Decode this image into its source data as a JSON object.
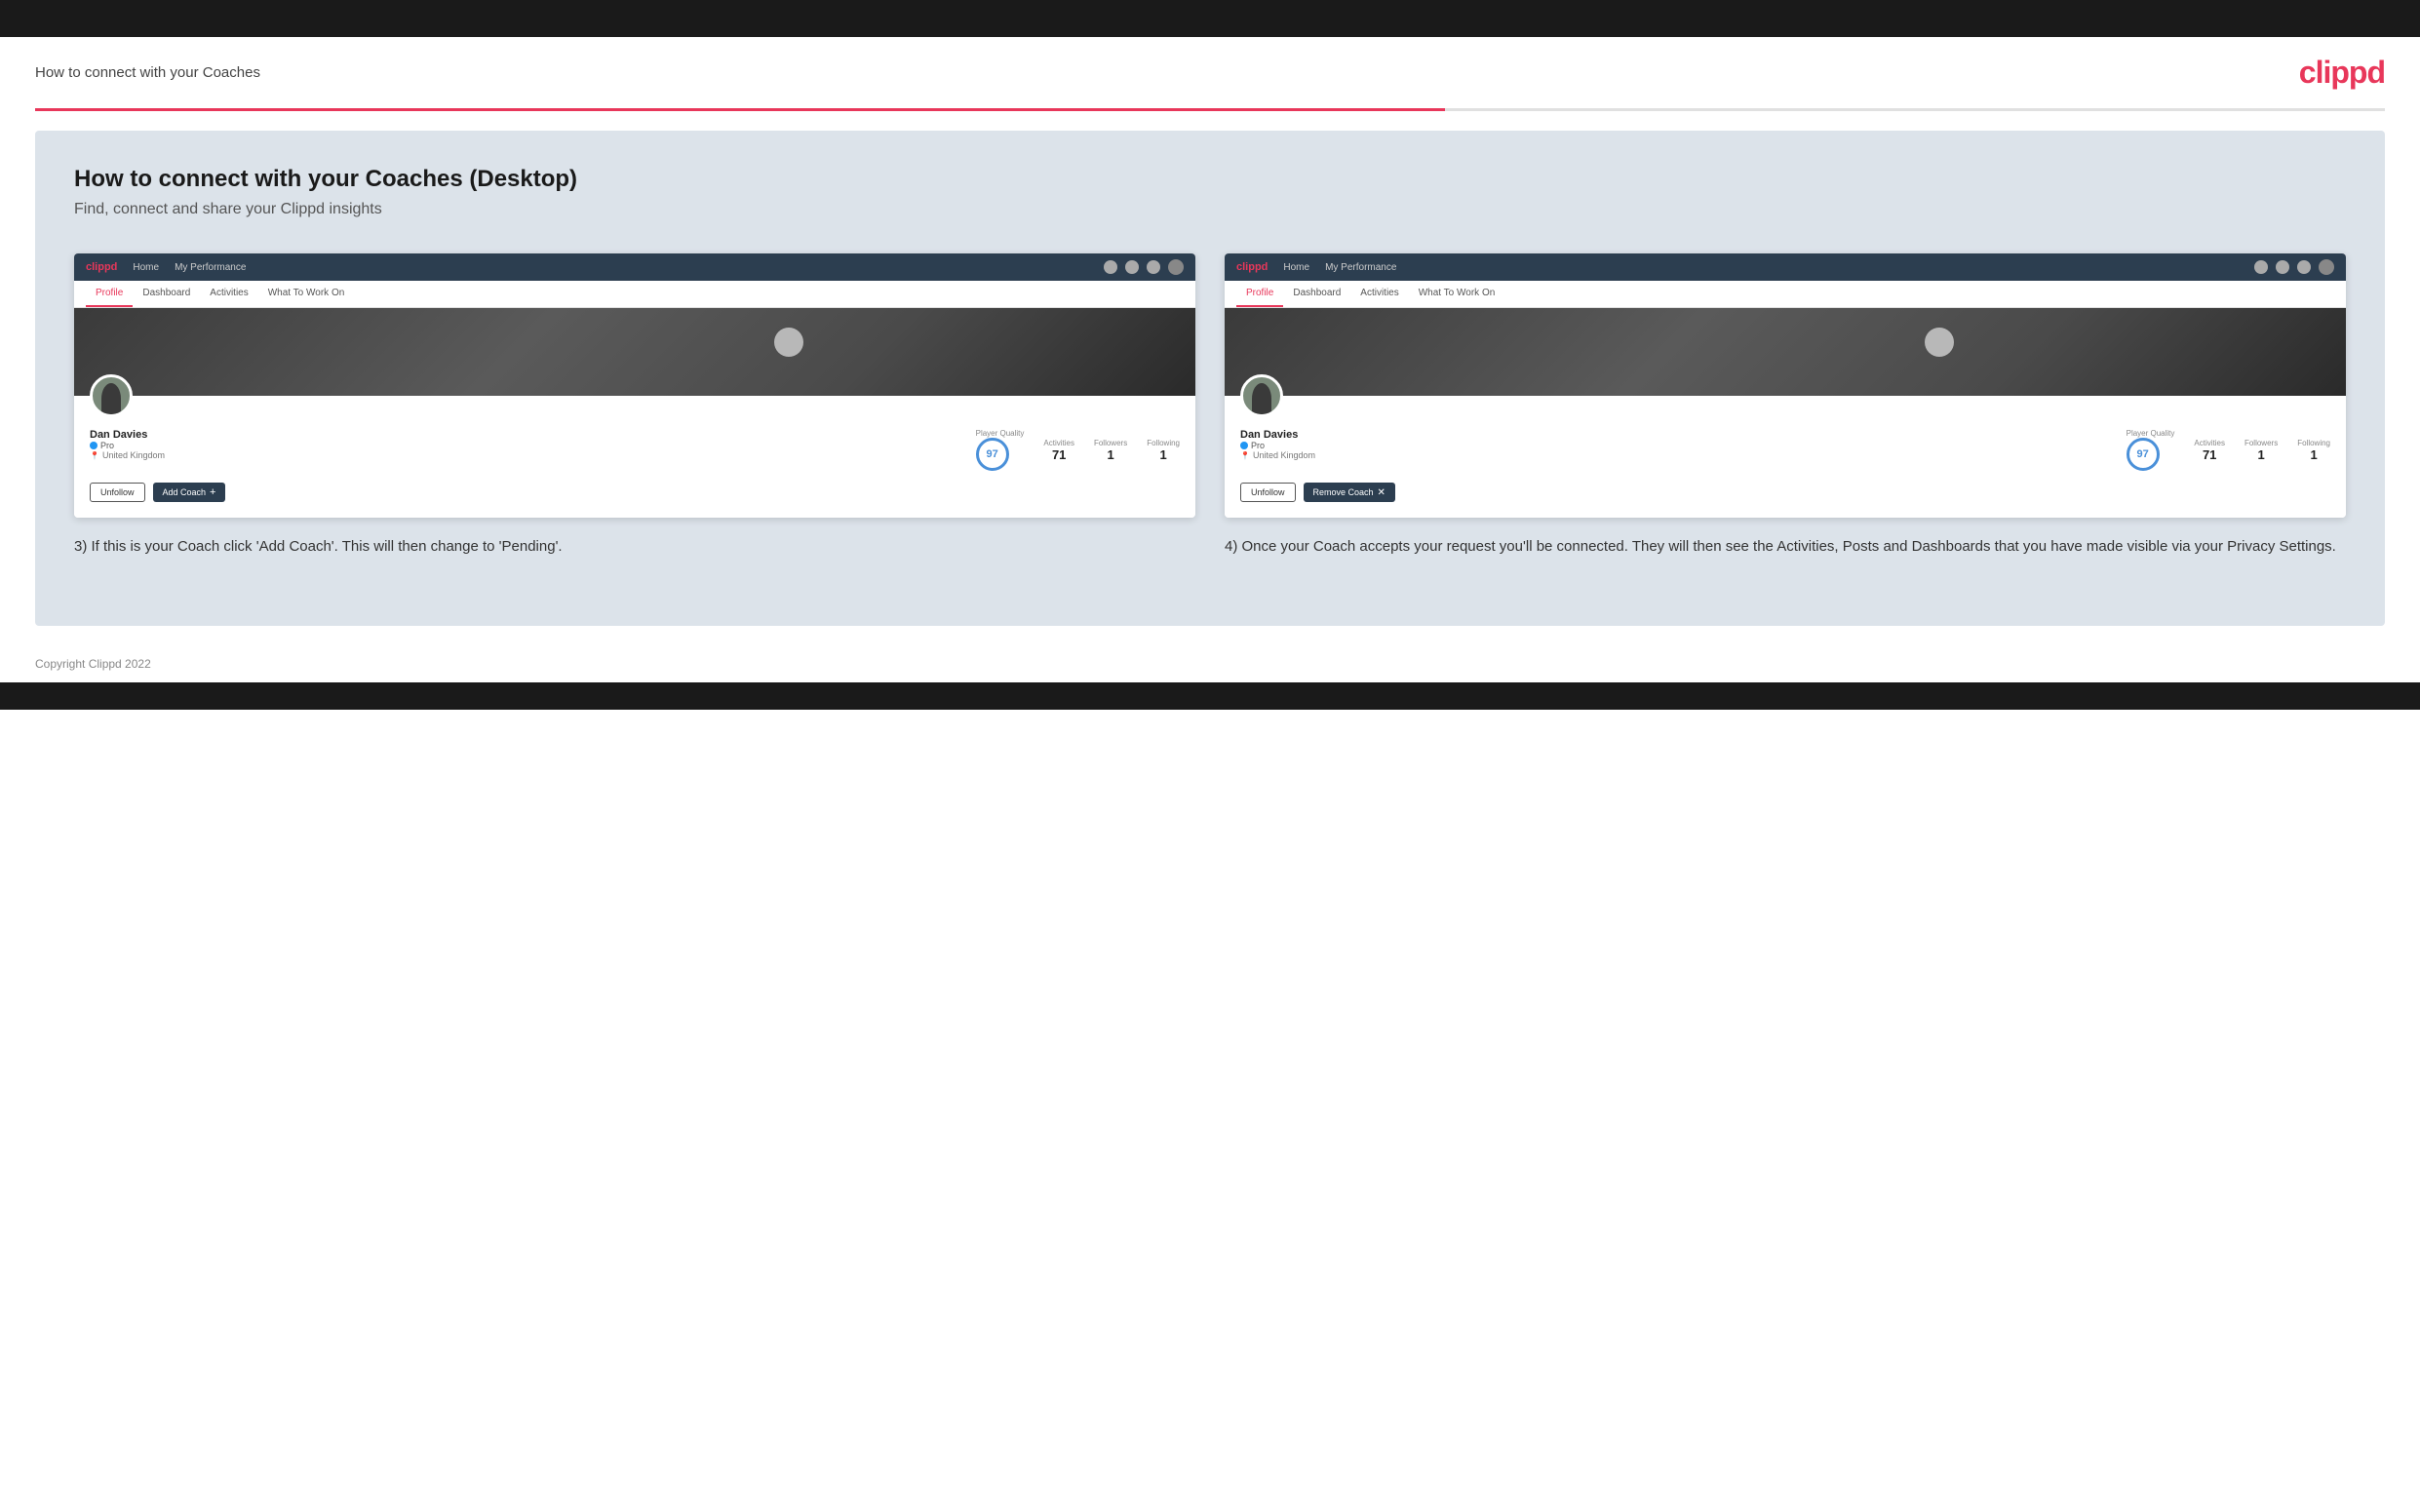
{
  "topBar": {},
  "header": {
    "title": "How to connect with your Coaches",
    "logo": "clippd"
  },
  "main": {
    "title": "How to connect with your Coaches (Desktop)",
    "subtitle": "Find, connect and share your Clippd insights",
    "screenshot1": {
      "nav": {
        "logo": "clippd",
        "items": [
          "Home",
          "My Performance"
        ]
      },
      "tabs": [
        "Profile",
        "Dashboard",
        "Activities",
        "What To Work On"
      ],
      "activeTab": "Profile",
      "user": {
        "name": "Dan Davies",
        "role": "Pro",
        "location": "United Kingdom"
      },
      "stats": {
        "playerQualityLabel": "Player Quality",
        "playerQualityValue": "97",
        "activitiesLabel": "Activities",
        "activitiesValue": "71",
        "followersLabel": "Followers",
        "followersValue": "1",
        "followingLabel": "Following",
        "followingValue": "1"
      },
      "buttons": {
        "unfollow": "Unfollow",
        "addCoach": "Add Coach"
      }
    },
    "screenshot2": {
      "nav": {
        "logo": "clippd",
        "items": [
          "Home",
          "My Performance"
        ]
      },
      "tabs": [
        "Profile",
        "Dashboard",
        "Activities",
        "What To Work On"
      ],
      "activeTab": "Profile",
      "user": {
        "name": "Dan Davies",
        "role": "Pro",
        "location": "United Kingdom"
      },
      "stats": {
        "playerQualityLabel": "Player Quality",
        "playerQualityValue": "97",
        "activitiesLabel": "Activities",
        "activitiesValue": "71",
        "followersLabel": "Followers",
        "followersValue": "1",
        "followingLabel": "Following",
        "followingValue": "1"
      },
      "buttons": {
        "unfollow": "Unfollow",
        "removeCoach": "Remove Coach"
      }
    },
    "description1": "3) If this is your Coach click 'Add Coach'. This will then change to 'Pending'.",
    "description2": "4) Once your Coach accepts your request you'll be connected. They will then see the Activities, Posts and Dashboards that you have made visible via your Privacy Settings."
  },
  "footer": {
    "copyright": "Copyright Clippd 2022"
  }
}
